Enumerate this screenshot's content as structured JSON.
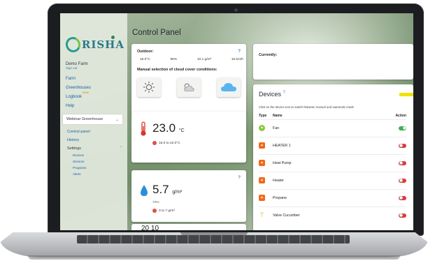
{
  "app": {
    "logo_text": "RISHA",
    "page_title": "Control Panel"
  },
  "sidebar": {
    "farm_name": "Demo Farm",
    "sign_out": "Sign out",
    "nav": [
      {
        "label": "Farm"
      },
      {
        "label": "Greenhouses"
      },
      {
        "label": "Logbook",
        "badge": "New"
      },
      {
        "label": "Help"
      }
    ],
    "greenhouse_select": "Webinar Greenhouse",
    "sub_nav": [
      {
        "label": "Control panel"
      },
      {
        "label": "History"
      }
    ],
    "settings_label": "Settings",
    "settings_items": [
      {
        "label": "Devices"
      },
      {
        "label": "Sensors"
      },
      {
        "label": "Programs"
      },
      {
        "label": "Alerts"
      }
    ]
  },
  "outdoor": {
    "label": "Outdoor:",
    "help": "?",
    "readings": [
      "16.0°C",
      "96%",
      "10.1 g/m³",
      "16 km/h"
    ],
    "manual_label": "Manual selection of cloud cover conditions:",
    "options": [
      {
        "icon": "sun-icon"
      },
      {
        "icon": "partly-cloudy-icon"
      },
      {
        "icon": "cloud-icon",
        "selected": true
      }
    ]
  },
  "temperature": {
    "value": "23.0",
    "unit": "°C",
    "range": "16.0 to 22.0°C",
    "icon": "thermometer-icon"
  },
  "humidity": {
    "value": "5.7",
    "unit": "g/m³",
    "percent": "72%",
    "range": "3 to 7 g/m³",
    "help": "?",
    "icon": "water-drop-icon"
  },
  "partial_card": {
    "text": "20  10"
  },
  "currently": {
    "label": "Currently:"
  },
  "devices": {
    "title": "Devices",
    "help": "?",
    "hint": "Click on the device icon to switch between manual and automatic mode",
    "columns": {
      "type": "Type",
      "name": "Name",
      "action": "Action"
    },
    "rows": [
      {
        "name": "Fan",
        "type": "fan",
        "on": true
      },
      {
        "name": "HEATER 1",
        "type": "heater",
        "on": false
      },
      {
        "name": "Heat Pump",
        "type": "heater",
        "on": false
      },
      {
        "name": "Heater",
        "type": "heater",
        "on": false
      },
      {
        "name": "Propane",
        "type": "heater",
        "on": false
      },
      {
        "name": "Valve Cucumber",
        "type": "valve",
        "on": false
      }
    ]
  },
  "colors": {
    "accent_blue": "#1d5fa8",
    "toggle_on": "#3cb34a",
    "toggle_off": "#e03a3a",
    "heater_orange": "#f06a1c",
    "fan_green": "#8cc63f",
    "valve_yellow": "#f2a81d"
  }
}
